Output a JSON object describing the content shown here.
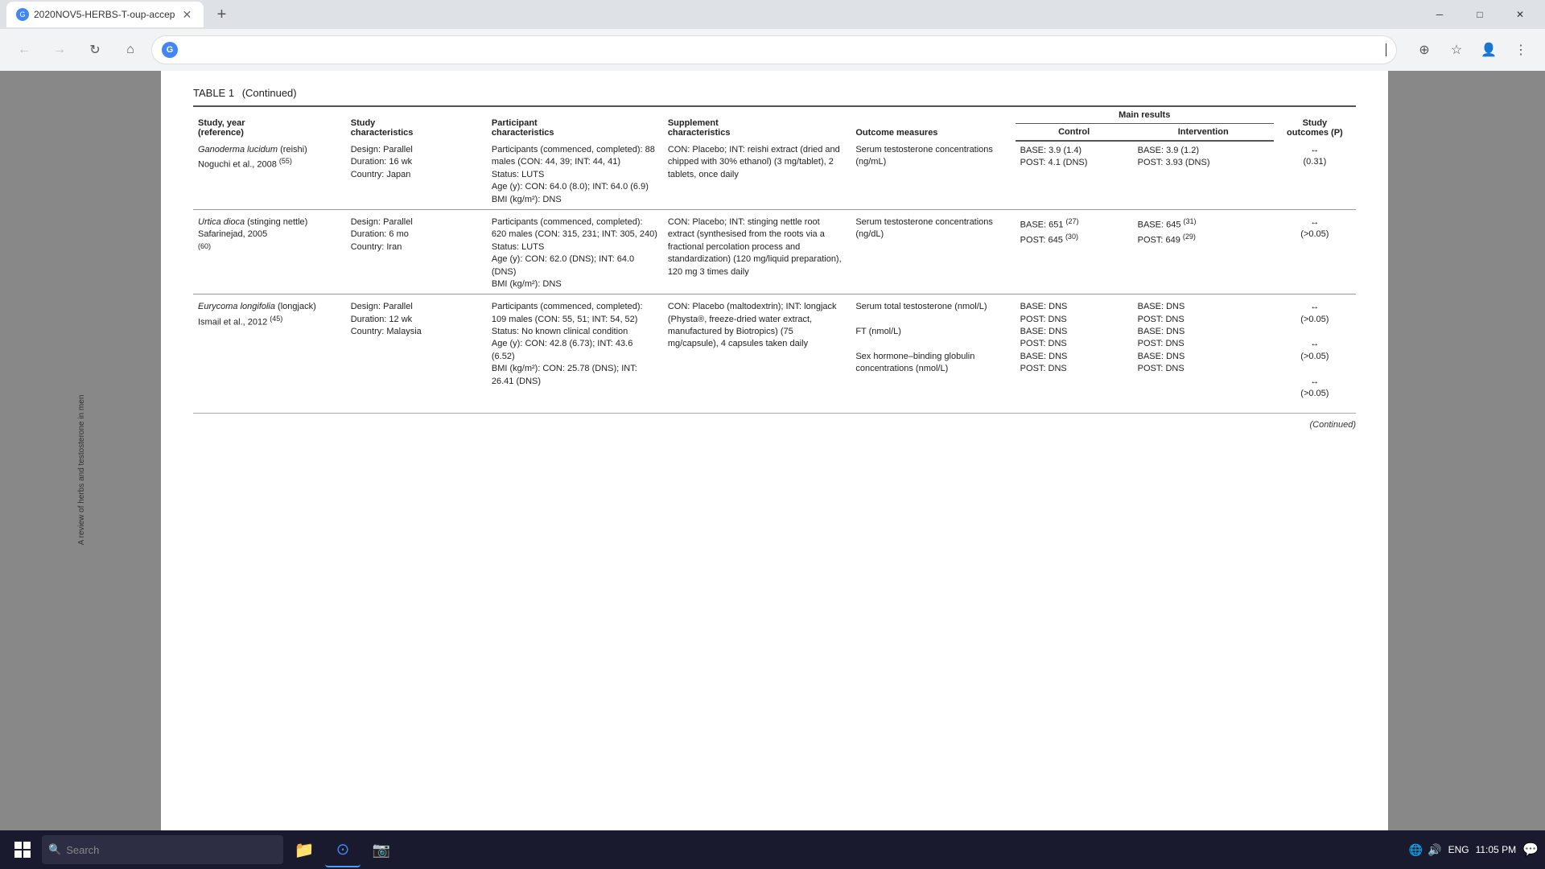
{
  "browser": {
    "tab_title": "2020NOV5-HERBS-T-oup-accep",
    "tab_favicon": "G",
    "new_tab_label": "+",
    "address_text": "G",
    "address_placeholder": "",
    "win_minimize": "─",
    "win_restore": "□",
    "win_close": "✕",
    "nav_back": "←",
    "nav_forward": "→",
    "nav_refresh": "↻",
    "nav_home": "⌂"
  },
  "table": {
    "title": "TABLE 1",
    "title_continued": "(Continued)",
    "continued_label": "(Continued)",
    "headers": {
      "study_year": "Study, year\n(reference)",
      "study_char": "Study\ncharacteristics",
      "participant_char": "Participant\ncharacteristics",
      "supplement_char": "Supplement\ncharacteristics",
      "outcome_measures": "Outcome measures",
      "main_results": "Main results",
      "control": "Control",
      "intervention": "Intervention",
      "study_outcomes": "Study\noutcomes (P)"
    },
    "rows": [
      {
        "study": "Ganoderma lucidum (reishi)",
        "study_sub": "Noguchi et al., 2008 (55)",
        "study_ref": "55",
        "design": "Design: Parallel",
        "duration": "Duration: 16 wk",
        "country": "Country: Japan",
        "participants": "Participants (commenced, completed): 88 males (CON: 44, 39; INT: 44, 41)",
        "status": "Status: LUTS",
        "age": "Age (y): CON: 64.0 (8.0); INT: 64.0 (6.9)",
        "bmi": "BMI (kg/m²): DNS",
        "supplement": "CON: Placebo; INT: reishi extract (dried and chipped with 30% ethanol) (3 mg/tablet), 2 tablets, once daily",
        "outcome": "Serum testosterone concentrations (ng/mL)",
        "control_base": "BASE: 3.9 (1.4)",
        "control_post": "POST: 4.1 (DNS)",
        "intervention_base": "BASE: 3.9 (1.2)",
        "intervention_post": "POST: 3.93 (DNS)",
        "study_outcome": "↔\n(0.31)"
      },
      {
        "study": "Urtica dioca (stinging nettle)",
        "study_sub": "Safarinejad, 2005",
        "study_ref": "60",
        "design": "Design: Parallel",
        "duration": "Duration: 6 mo",
        "country": "Country: Iran",
        "participants": "Participants (commenced, completed): 620 males (CON: 315, 231; INT: 305, 240)",
        "status": "Status: LUTS",
        "age": "Age (y): CON: 62.0 (DNS); INT: 64.0 (DNS)",
        "bmi": "BMI (kg/m²): DNS",
        "supplement": "CON: Placebo; INT: stinging nettle root extract (synthesised from the roots via a fractional percolation process and standardization) (120 mg/liquid preparation), 120 mg 3 times daily",
        "outcome": "Serum testosterone concentrations (ng/dL)",
        "control_base": "BASE: 651 (27)",
        "control_post": "POST: 645 (30)",
        "intervention_base": "BASE: 645 (31)",
        "intervention_post": "POST: 649 (29)",
        "study_outcome": "↔\n(>0.05)"
      },
      {
        "study": "Eurycoma longifolia (longjack)",
        "study_sub": "Ismail et al., 2012 (45)",
        "study_ref": "45",
        "design": "Design: Parallel",
        "duration": "Duration: 12 wk",
        "country": "Country: Malaysia",
        "participants": "Participants (commenced, completed): 109 males (CON: 55, 51; INT: 54, 52)",
        "status": "Status: No known clinical condition",
        "age": "Age (y): CON: 42.8 (6.73); INT: 43.6 (6.52)",
        "bmi": "BMI (kg/m²): CON: 25.78 (DNS); INT: 26.41 (DNS)",
        "supplement": "CON: Placebo (maltodextrin); INT: longjack (Physta®, freeze-dried water extract, manufactured by Biotropics) (75 mg/capsule), 4 capsules taken daily",
        "outcome_multi": [
          "Serum total testosterone (nmol/L)",
          "FT (nmol/L)",
          "Sex hormone–binding globulin concentrations (nmol/L)"
        ],
        "control_base_multi": [
          "BASE: DNS",
          "BASE: DNS",
          "BASE: DNS"
        ],
        "control_post_multi": [
          "POST: DNS",
          "POST: DNS",
          "POST: DNS"
        ],
        "intervention_base_multi": [
          "BASE: DNS",
          "BASE: DNS",
          "BASE: DNS"
        ],
        "intervention_post_multi": [
          "POST: DNS",
          "POST: DNS",
          "POST: DNS"
        ],
        "study_outcome_multi": [
          "↔\n(>0.05)",
          "↔\n(>0.05)",
          "↔\n(>0.05)"
        ]
      }
    ]
  },
  "vertical_text": "A review of herbs and testosterone in men",
  "taskbar": {
    "time": "11:05 PM",
    "date": "ENG",
    "search_placeholder": "Search"
  }
}
